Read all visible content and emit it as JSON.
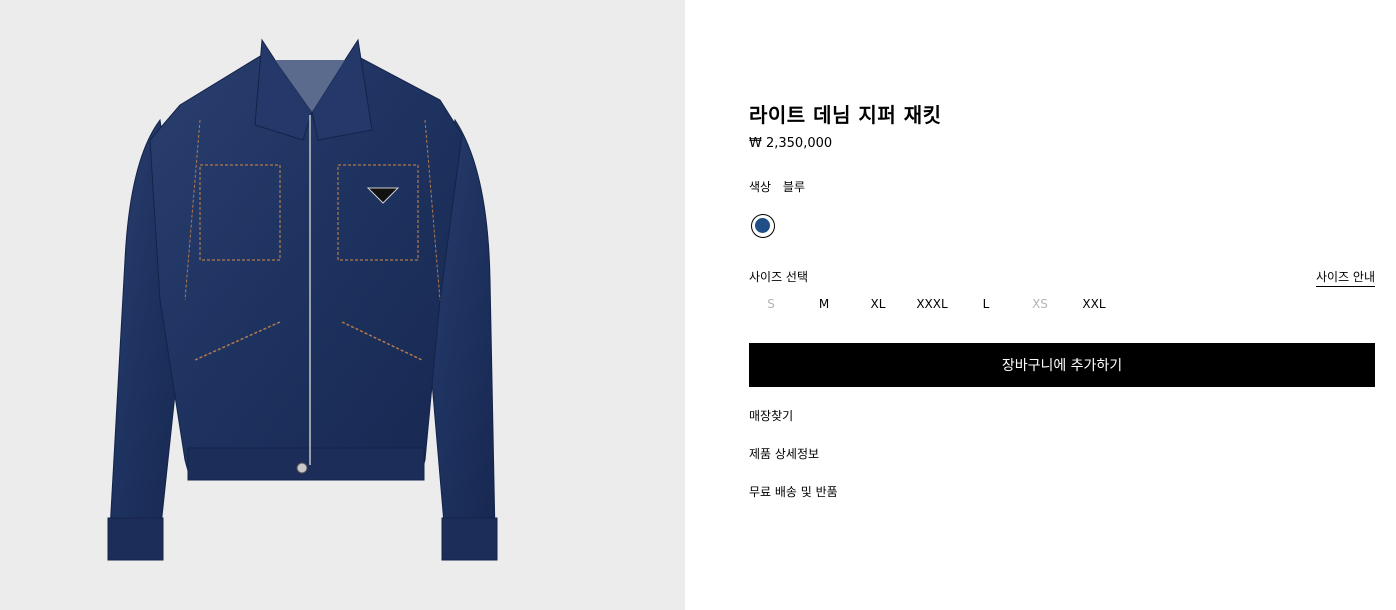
{
  "product": {
    "title": "라이트 데님 지퍼 재킷",
    "price": "₩ 2,350,000",
    "image_icon": "denim-jacket-image"
  },
  "color": {
    "label": "색상",
    "value": "블루",
    "swatch_hex": "#1f4f86"
  },
  "size": {
    "label": "사이즈 선택",
    "guide_label": "사이즈 안내",
    "options": [
      {
        "label": "S",
        "available": false
      },
      {
        "label": "M",
        "available": true
      },
      {
        "label": "XL",
        "available": true
      },
      {
        "label": "XXXL",
        "available": true
      },
      {
        "label": "L",
        "available": true
      },
      {
        "label": "XS",
        "available": false
      },
      {
        "label": "XXL",
        "available": true
      }
    ]
  },
  "actions": {
    "add_to_cart": "장바구니에 추가하기"
  },
  "links": {
    "find_store": "매장찾기",
    "details": "제품 상세정보",
    "shipping": "무료 배송 및 반품"
  },
  "colors": {
    "background": "#ffffff",
    "gallery_bg": "#ececec",
    "button_bg": "#000000",
    "unavailable_text": "#b5b5b5"
  }
}
